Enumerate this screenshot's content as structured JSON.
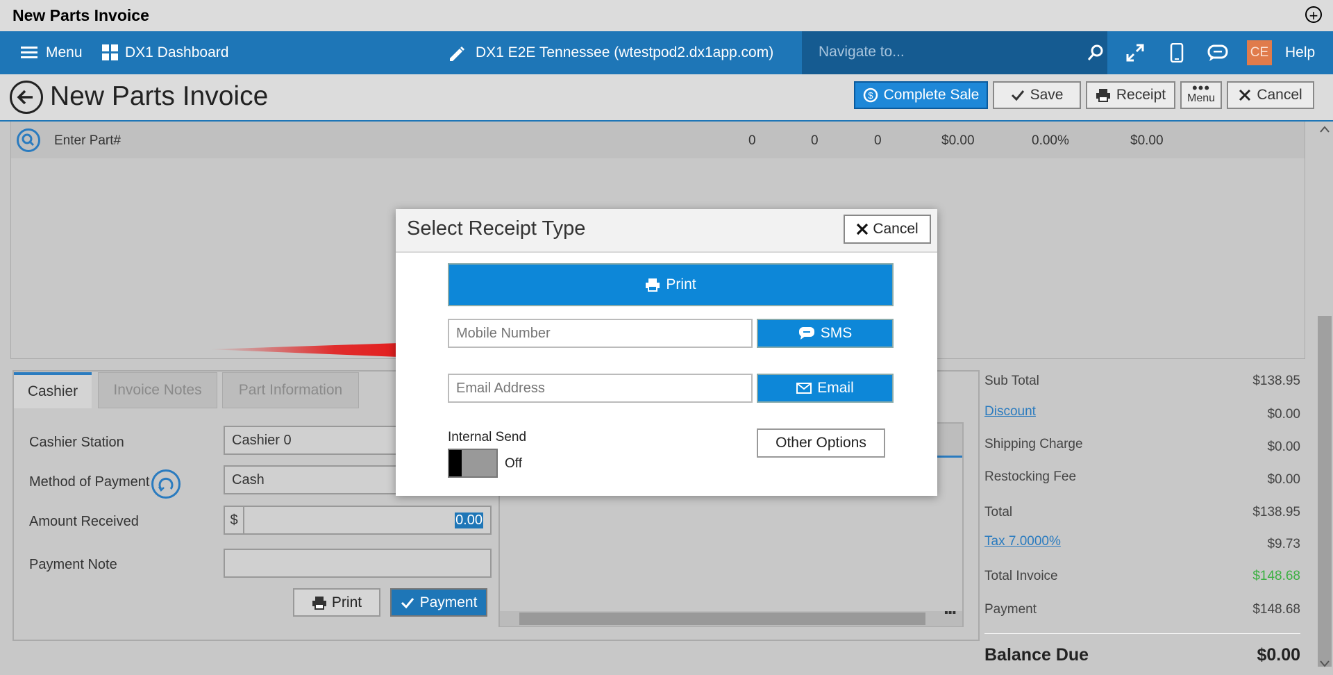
{
  "window": {
    "title": "New Parts Invoice"
  },
  "nav": {
    "menu_label": "Menu",
    "dashboard_label": "DX1 Dashboard",
    "location_label": "DX1 E2E Tennessee (wtestpod2.dx1app.com)",
    "search_placeholder": "Navigate to...",
    "avatar_initials": "CE",
    "help_label": "Help"
  },
  "page": {
    "title": "New Parts Invoice",
    "toolbar": {
      "complete_sale": "Complete Sale",
      "save": "Save",
      "receipt": "Receipt",
      "menu": "Menu",
      "cancel": "Cancel"
    }
  },
  "parts": {
    "placeholder": "Enter Part#",
    "values": [
      "0",
      "0",
      "0",
      "$0.00",
      "0.00%",
      "$0.00"
    ]
  },
  "tabs": [
    "Cashier",
    "Invoice Notes",
    "Part Information"
  ],
  "cashier": {
    "station_label": "Cashier Station",
    "station_value": "Cashier 0",
    "payment_method_label": "Method of Payment",
    "payment_method_value": "Cash",
    "amount_label": "Amount Received",
    "currency_symbol": "$",
    "amount_value": "0.00",
    "note_label": "Payment Note",
    "print_button": "Print",
    "payment_button": "Payment"
  },
  "summary": {
    "sub_total_label": "Sub Total",
    "sub_total": "$138.95",
    "discount_label": "Discount",
    "discount": "$0.00",
    "shipping_label": "Shipping Charge",
    "shipping": "$0.00",
    "restocking_label": "Restocking Fee",
    "restocking": "$0.00",
    "total_label": "Total",
    "total": "$138.95",
    "tax_label": "Tax 7.0000%",
    "tax": "$9.73",
    "total_invoice_label": "Total Invoice",
    "total_invoice": "$148.68",
    "payment_label": "Payment",
    "payment": "$148.68",
    "balance_due_label": "Balance Due",
    "balance_due": "$0.00",
    "colors": {
      "total_invoice": "#3cb043"
    }
  },
  "modal": {
    "title": "Select Receipt Type",
    "cancel": "Cancel",
    "print": "Print",
    "mobile_placeholder": "Mobile Number",
    "sms": "SMS",
    "email_placeholder": "Email Address",
    "email": "Email",
    "internal_send_label": "Internal Send",
    "toggle_state": "Off",
    "other_options": "Other Options"
  },
  "colors": {
    "accent": "#1e76b7",
    "primary_button": "#0d87d8",
    "annotation_arrow": "#e31b1b"
  }
}
